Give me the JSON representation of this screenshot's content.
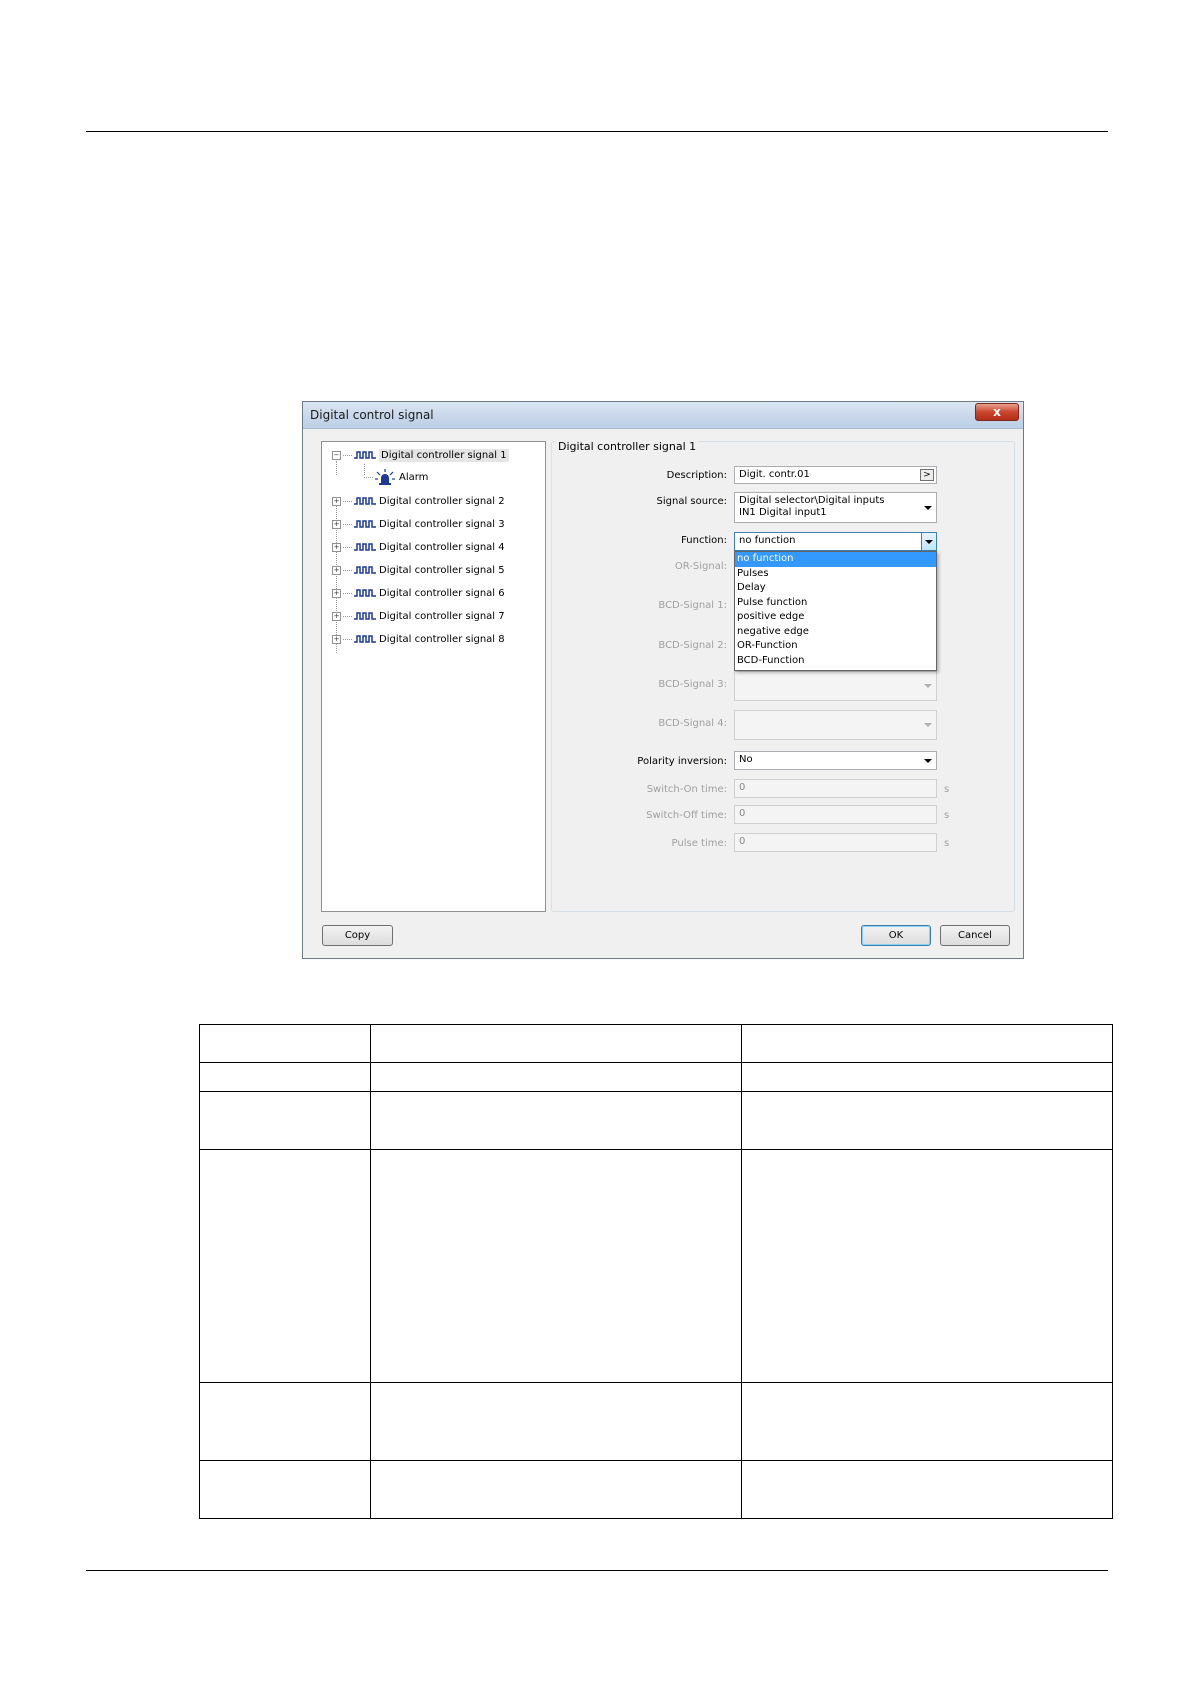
{
  "window": {
    "title": "Digital control signal",
    "close_label": "x"
  },
  "tree": {
    "items": [
      {
        "label": "Digital controller signal 1",
        "expander": "−"
      },
      {
        "label": "Alarm"
      },
      {
        "label": "Digital controller signal 2",
        "expander": "+"
      },
      {
        "label": "Digital controller signal 3",
        "expander": "+"
      },
      {
        "label": "Digital controller signal 4",
        "expander": "+"
      },
      {
        "label": "Digital controller signal 5",
        "expander": "+"
      },
      {
        "label": "Digital controller signal 6",
        "expander": "+"
      },
      {
        "label": "Digital controller signal 7",
        "expander": "+"
      },
      {
        "label": "Digital controller signal 8",
        "expander": "+"
      }
    ]
  },
  "panel": {
    "group_title": "Digital controller signal 1",
    "description": {
      "label": "Description:",
      "value": "Digit. contr.01",
      "button": ">"
    },
    "signal_source": {
      "label": "Signal source:",
      "line1": "Digital selector\\Digital inputs",
      "line2": "IN1 Digital input1"
    },
    "function": {
      "label": "Function:",
      "value": "no function",
      "options": [
        "no function",
        "Pulses",
        "Delay",
        "Pulse function",
        "positive edge",
        "negative edge",
        "OR-Function",
        "BCD-Function"
      ]
    },
    "or_signal": {
      "label": "OR-Signal:"
    },
    "bcd1": {
      "label": "BCD-Signal 1:"
    },
    "bcd2": {
      "label": "BCD-Signal 2:"
    },
    "bcd3": {
      "label": "BCD-Signal 3:"
    },
    "bcd4": {
      "label": "BCD-Signal 4:"
    },
    "polarity": {
      "label": "Polarity inversion:",
      "value": "No"
    },
    "switch_on": {
      "label": "Switch-On time:",
      "value": "0",
      "unit": "s"
    },
    "switch_off": {
      "label": "Switch-Off time:",
      "value": "0",
      "unit": "s"
    },
    "pulse": {
      "label": "Pulse time:",
      "value": "0",
      "unit": "s"
    }
  },
  "buttons": {
    "copy": "Copy",
    "ok": "OK",
    "cancel": "Cancel"
  },
  "colors": {
    "selection": "#3399ff",
    "titlebar": "#c8d7ea",
    "close": "#c9462e",
    "icon_blue": "#1f3a93"
  }
}
